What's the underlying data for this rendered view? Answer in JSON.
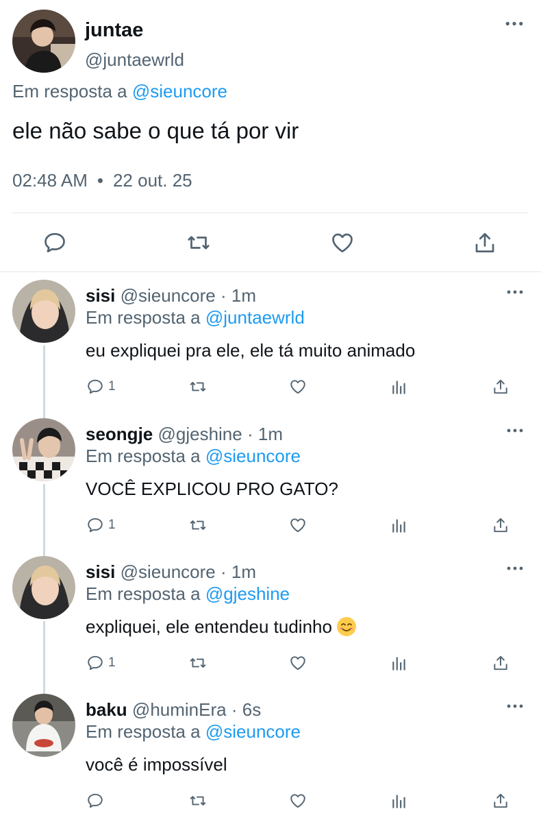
{
  "main_tweet": {
    "name": "juntae",
    "handle": "@juntaewrld",
    "reply_prefix": "Em resposta a",
    "reply_to": "@sieuncore",
    "text": "ele não sabe o que tá por vir",
    "time": "02:48 AM",
    "date": "22 out. 25",
    "dot": "•"
  },
  "replies": [
    {
      "name": "sisi",
      "handle": "@sieuncore",
      "time_sep": "·",
      "time": "1m",
      "reply_prefix": "Em resposta a",
      "reply_to": "@juntaewrld",
      "text": "eu expliquei pra ele, ele tá muito animado",
      "reply_count": "1"
    },
    {
      "name": "seongje",
      "handle": "@gjeshine",
      "time_sep": "·",
      "time": "1m",
      "reply_prefix": "Em resposta a",
      "reply_to": "@sieuncore",
      "text": "VOCÊ EXPLICOU PRO GATO?",
      "reply_count": "1"
    },
    {
      "name": "sisi",
      "handle": "@sieuncore",
      "time_sep": "·",
      "time": "1m",
      "reply_prefix": "Em resposta a",
      "reply_to": "@gjeshine",
      "text": "expliquei, ele entendeu tudinho",
      "emoji": "smiling-face-emoji",
      "reply_count": "1"
    },
    {
      "name": "baku",
      "handle": "@huminEra",
      "time_sep": "·",
      "time": "6s",
      "reply_prefix": "Em resposta a",
      "reply_to": "@sieuncore",
      "text": "você é impossível",
      "reply_count": ""
    }
  ],
  "colors": {
    "text": "#0f1419",
    "secondary": "#536471",
    "link": "#1d9bf0",
    "divider": "#e1e8ed"
  },
  "icons": [
    "more-icon",
    "reply-icon",
    "retweet-icon",
    "like-icon",
    "analytics-icon",
    "share-icon"
  ]
}
